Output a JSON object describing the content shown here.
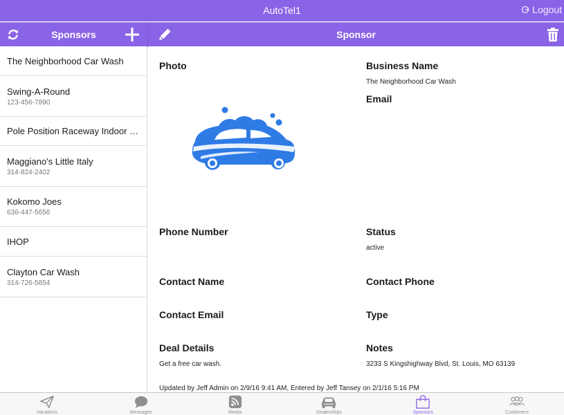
{
  "app": {
    "title": "AutoTel1",
    "logout_label": "Logout"
  },
  "nav": {
    "left_title": "Sponsors",
    "right_title": "Sponsor"
  },
  "sponsors": [
    {
      "name": "The Neighborhood Car Wash",
      "phone": ""
    },
    {
      "name": "Swing-A-Round",
      "phone": "123-456-7890"
    },
    {
      "name": "Pole Position Raceway Indoor K...",
      "phone": ""
    },
    {
      "name": "Maggiano's Little Italy",
      "phone": "314-824-2402"
    },
    {
      "name": "Kokomo Joes",
      "phone": "636-447-5656"
    },
    {
      "name": "IHOP",
      "phone": ""
    },
    {
      "name": "Clayton Car Wash",
      "phone": "314-726-5854"
    }
  ],
  "detail": {
    "photo_label": "Photo",
    "business_name_label": "Business Name",
    "business_name": "The Neighborhood Car Wash",
    "email_label": "Email",
    "email": "",
    "phone_label": "Phone Number",
    "phone": "",
    "status_label": "Status",
    "status": "active",
    "contact_name_label": "Contact Name",
    "contact_name": "",
    "contact_phone_label": "Contact Phone",
    "contact_phone": "",
    "contact_email_label": "Contact Email",
    "contact_email": "",
    "type_label": "Type",
    "type": "",
    "deal_details_label": "Deal Details",
    "deal_details": "Get a free car wash.",
    "notes_label": "Notes",
    "notes": "3233 S Kingshighway Blvd, St. Louis, MO 63139",
    "updated_line": "Updated by Jeff Admin on 2/9/16 9:41 AM, Entered by Jeff Tansey on 2/1/16 5:16 PM"
  },
  "tabs": [
    {
      "label": "Vacations",
      "icon": "paper-plane-icon"
    },
    {
      "label": "Messages",
      "icon": "chat-bubble-icon"
    },
    {
      "label": "Media",
      "icon": "rss-icon"
    },
    {
      "label": "Dealerships",
      "icon": "car-icon"
    },
    {
      "label": "Sponsors",
      "icon": "shopping-bag-icon",
      "active": true
    },
    {
      "label": "Customers",
      "icon": "people-icon"
    }
  ],
  "colors": {
    "accent": "#8a64e6",
    "photo_blue": "#2f7be6",
    "tab_inactive": "#8e8e8e"
  }
}
